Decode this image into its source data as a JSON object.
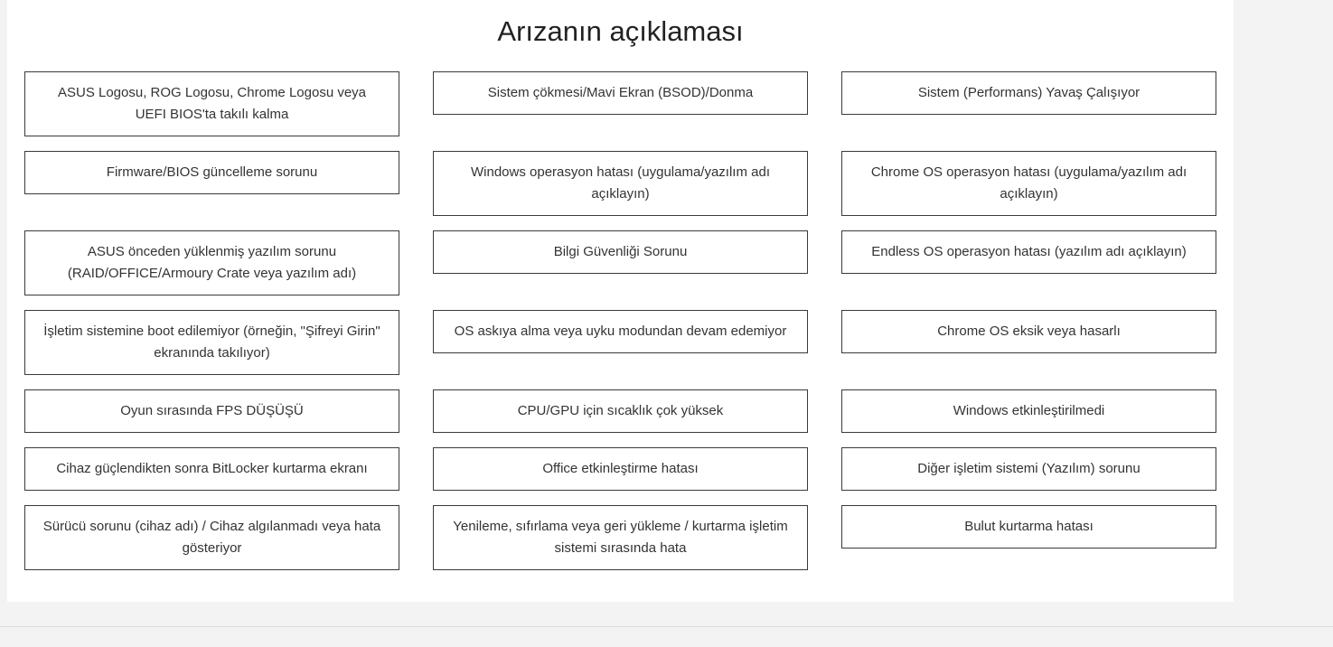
{
  "page": {
    "title": "Arızanın açıklaması"
  },
  "options": [
    [
      "ASUS Logosu, ROG Logosu, Chrome Logosu veya UEFI BIOS'ta takılı kalma",
      "Sistem çökmesi/Mavi Ekran (BSOD)/Donma",
      "Sistem (Performans) Yavaş Çalışıyor"
    ],
    [
      "Firmware/BIOS güncelleme sorunu",
      "Windows operasyon hatası (uygulama/yazılım adı açıklayın)",
      "Chrome OS operasyon hatası (uygulama/yazılım adı açıklayın)"
    ],
    [
      "ASUS önceden yüklenmiş yazılım sorunu (RAID/OFFICE/Armoury Crate veya yazılım adı)",
      "Bilgi Güvenliği Sorunu",
      "Endless OS operasyon hatası (yazılım adı açıklayın)"
    ],
    [
      "İşletim sistemine boot edilemiyor (örneğin, \"Şifreyi Girin\" ekranında takılıyor)",
      "OS askıya alma veya uyku modundan devam edemiyor",
      "Chrome OS eksik veya hasarlı"
    ],
    [
      "Oyun sırasında FPS DÜŞÜŞÜ",
      "CPU/GPU için sıcaklık çok yüksek",
      "Windows etkinleştirilmedi"
    ],
    [
      "Cihaz güçlendikten sonra BitLocker kurtarma ekranı",
      "Office etkinleştirme hatası",
      "Diğer işletim sistemi (Yazılım) sorunu"
    ],
    [
      "Sürücü sorunu (cihaz adı) / Cihaz algılanmadı veya hata gösteriyor",
      "Yenileme, sıfırlama veya geri yükleme / kurtarma işletim sistemi sırasında hata",
      "Bulut kurtarma hatası"
    ]
  ]
}
